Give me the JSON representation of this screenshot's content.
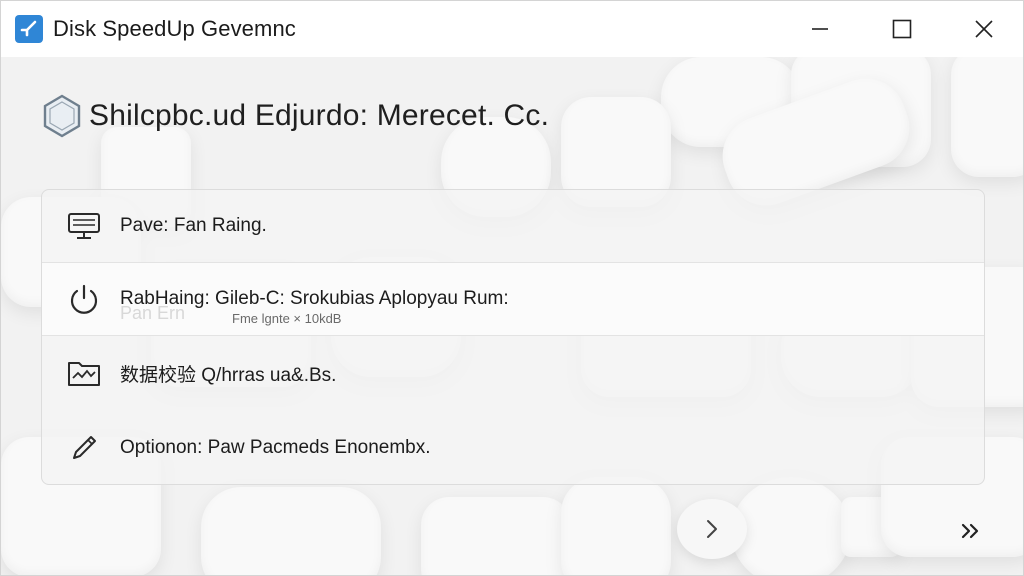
{
  "window": {
    "title": "Disk SpeedUp Gevemnc",
    "controls": [
      "minimize",
      "maximize",
      "close"
    ]
  },
  "header": {
    "title": "Shilcpbc.ud Edjurdo: Merecet. Cc."
  },
  "rows": [
    {
      "label": "Pave: Fan Raing.",
      "icon": "monitor-icon"
    },
    {
      "label": "RabHaing: Gileb-C: Srokubias Aplopyau Rum:",
      "sublabel": "Fme lgnte × 10kdB",
      "icon": "power-icon"
    },
    {
      "label": "数据校验 Q/hrras ua&.Bs.",
      "icon": "chart-folder-icon"
    },
    {
      "label": "Optionon: Paw Pacmeds Enonembx.",
      "icon": "pencil-icon"
    }
  ],
  "footer": {
    "next_icon": "chevron-right-icon",
    "skip_icon": "double-chevron-icon"
  },
  "colors": {
    "accent": "#2f86d6",
    "background": "#f2f2f2",
    "titlebar": "#ffffff"
  }
}
